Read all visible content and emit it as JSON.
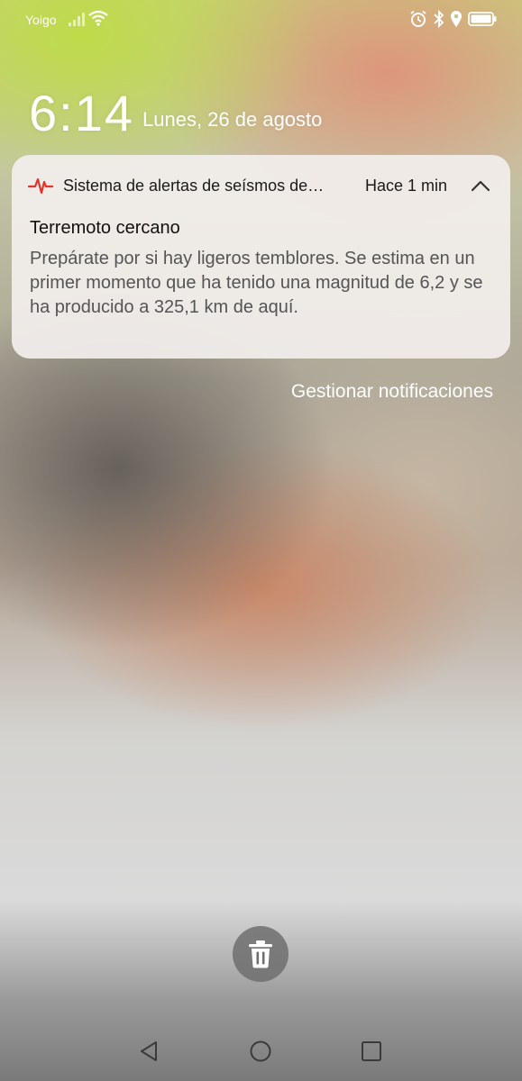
{
  "status_bar": {
    "carrier": "Yoigo",
    "icons": [
      "signal-icon",
      "wifi-icon",
      "alarm-icon",
      "bluetooth-icon",
      "location-icon",
      "battery-icon"
    ]
  },
  "lock_screen": {
    "time": "6:14",
    "date": "Lunes, 26 de agosto"
  },
  "notification": {
    "app_name": "Sistema de alertas de seísmos de…",
    "time_ago": "Hace 1 min",
    "app_icon": "seismic-wave-icon",
    "accent_color": "#e0342b",
    "title": "Terremoto cercano",
    "body": "Prepárate por si hay ligeros temblores. Se estima en un primer momento que ha tenido una magnitud de 6,2 y se ha producido a 325,1 km de aquí."
  },
  "manage_notifications_label": "Gestionar notificaciones",
  "actions": {
    "clear_icon": "trash-icon"
  },
  "nav_bar": {
    "buttons": [
      "back-icon",
      "home-icon",
      "recents-icon"
    ]
  }
}
